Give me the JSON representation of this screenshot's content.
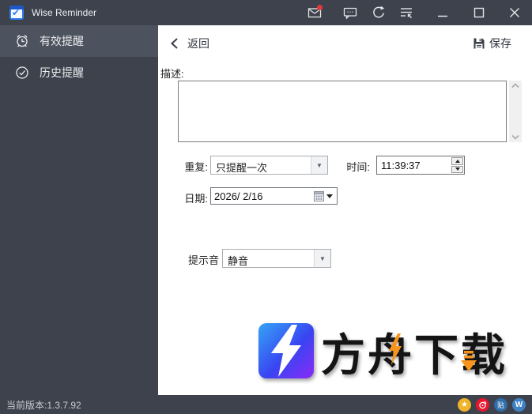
{
  "window": {
    "title": "Wise Reminder"
  },
  "titlebar": {
    "icons": [
      {
        "name": "mail-icon",
        "badge": true
      },
      {
        "name": "feedback-icon"
      },
      {
        "name": "refresh-icon"
      },
      {
        "name": "tray-icon"
      },
      {
        "name": "minimize-icon"
      },
      {
        "name": "maximize-icon"
      },
      {
        "name": "close-icon"
      }
    ]
  },
  "sidebar": {
    "items": [
      {
        "icon": "alarm-clock-icon",
        "label": "有效提醒",
        "selected": true
      },
      {
        "icon": "check-circle-icon",
        "label": "历史提醒",
        "selected": false
      }
    ]
  },
  "toolbar": {
    "back_label": "返回",
    "save_label": "保存"
  },
  "form": {
    "description_label": "描述:",
    "description_value": "",
    "repeat_label": "重复:",
    "repeat_value": "只提醒一次",
    "time_label": "时间:",
    "time_value": "11:39:37",
    "date_label": "日期:",
    "date_value": "2026/ 2/16",
    "sound_label": "提示音",
    "sound_value": "静音"
  },
  "statusbar": {
    "version": "当前版本:1.3.7.92",
    "social": [
      {
        "name": "star-icon",
        "color": "#f0b429",
        "glyph": "★"
      },
      {
        "name": "weibo-icon",
        "color": "#e6162d"
      },
      {
        "name": "tieba-icon",
        "color": "#2f6da8",
        "glyph": "贴"
      },
      {
        "name": "w-icon",
        "color": "#3f83c6",
        "glyph": "W"
      }
    ]
  },
  "watermark": {
    "text": "方舟下载"
  },
  "colors": {
    "titlebar_bg": "#3d424c",
    "sidebar_selected_bg": "#4d535e",
    "badge_red": "#e4393c",
    "app_icon_blue": "#2f7df0",
    "logo_gradient_start": "#35a4f6",
    "logo_gradient_end": "#8a2bf8",
    "watermark_orange": "#f7941d"
  }
}
